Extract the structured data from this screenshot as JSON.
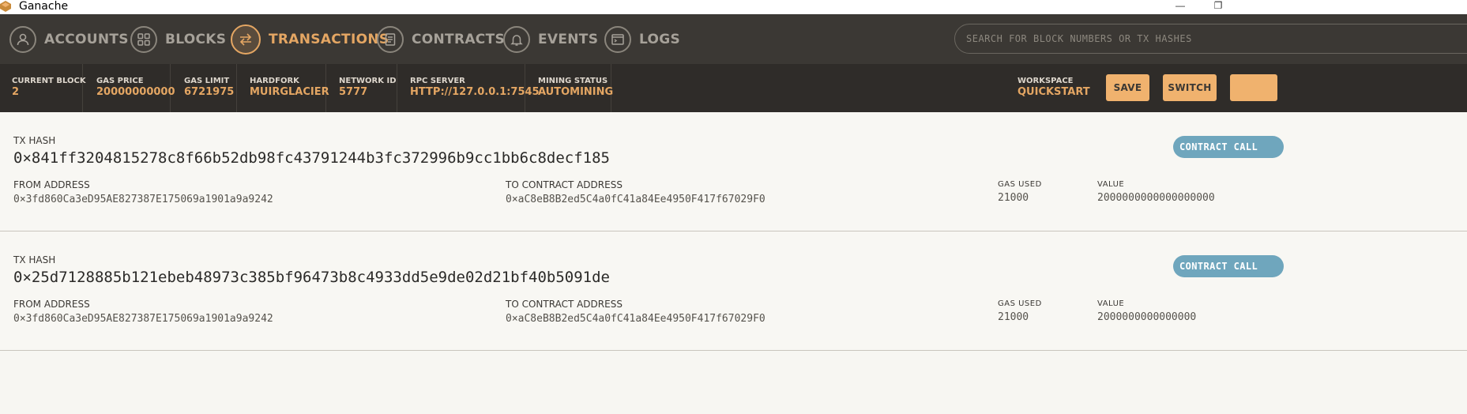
{
  "window": {
    "title": "Ganache"
  },
  "nav": {
    "items": [
      {
        "label": "ACCOUNTS"
      },
      {
        "label": "BLOCKS"
      },
      {
        "label": "TRANSACTIONS",
        "active": true
      },
      {
        "label": "CONTRACTS"
      },
      {
        "label": "EVENTS"
      },
      {
        "label": "LOGS"
      }
    ],
    "search_placeholder": "SEARCH FOR BLOCK NUMBERS OR TX HASHES"
  },
  "status": {
    "current_block": {
      "label": "CURRENT BLOCK",
      "value": "2"
    },
    "gas_price": {
      "label": "GAS PRICE",
      "value": "20000000000"
    },
    "gas_limit": {
      "label": "GAS LIMIT",
      "value": "6721975"
    },
    "hardfork": {
      "label": "HARDFORK",
      "value": "MUIRGLACIER"
    },
    "network_id": {
      "label": "NETWORK ID",
      "value": "5777"
    },
    "rpc_server": {
      "label": "RPC SERVER",
      "value": "HTTP://127.0.0.1:7545"
    },
    "mining_status": {
      "label": "MINING STATUS",
      "value": "AUTOMINING"
    },
    "workspace": {
      "label": "WORKSPACE",
      "value": "QUICKSTART"
    },
    "save_label": "SAVE",
    "switch_label": "SWITCH"
  },
  "transactions": [
    {
      "hash_label": "TX HASH",
      "hash": "0×841ff3204815278c8f66b52db98fc43791244b3fc372996b9cc1bb6c8decf185",
      "badge": "CONTRACT CALL",
      "from_label": "FROM ADDRESS",
      "from": "0×3fd860Ca3eD95AE827387E175069a1901a9a9242",
      "to_label": "TO CONTRACT ADDRESS",
      "to": "0×aC8eB8B2ed5C4a0fC41a84Ee4950F417f67029F0",
      "gas_used_label": "GAS USED",
      "gas_used": "21000",
      "value_label": "VALUE",
      "value": "2000000000000000000"
    },
    {
      "hash_label": "TX HASH",
      "hash": "0×25d7128885b121ebeb48973c385bf96473b8c4933dd5e9de02d21bf40b5091de",
      "badge": "CONTRACT CALL",
      "from_label": "FROM ADDRESS",
      "from": "0×3fd860Ca3eD95AE827387E175069a1901a9a9242",
      "to_label": "TO CONTRACT ADDRESS",
      "to": "0×aC8eB8B2ed5C4a0fC41a84Ee4950F417f67029F0",
      "gas_used_label": "GAS USED",
      "gas_used": "21000",
      "value_label": "VALUE",
      "value": "2000000000000000"
    }
  ]
}
